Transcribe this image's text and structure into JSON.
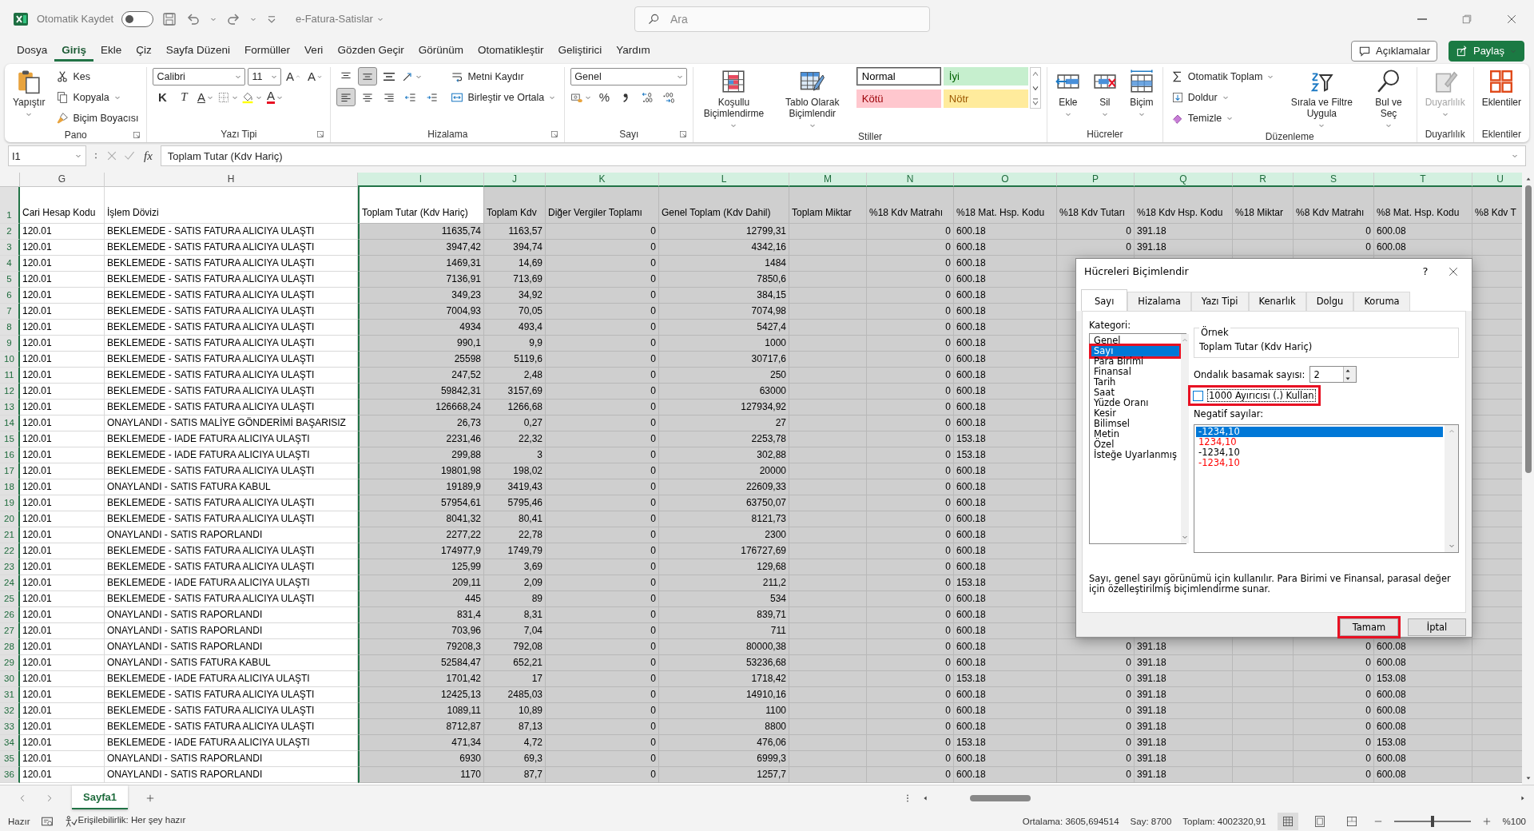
{
  "titlebar": {
    "autosave_label": "Otomatik Kaydet",
    "autosave_on": false,
    "file_name": "e-Fatura-Satislar",
    "search": {
      "placeholder": "Ara"
    }
  },
  "menu": [
    {
      "label": "Dosya",
      "selected": false
    },
    {
      "label": "Giriş",
      "selected": true
    },
    {
      "label": "Ekle",
      "selected": false
    },
    {
      "label": "Çiz",
      "selected": false
    },
    {
      "label": "Sayfa Düzeni",
      "selected": false
    },
    {
      "label": "Formüller",
      "selected": false
    },
    {
      "label": "Veri",
      "selected": false
    },
    {
      "label": "Gözden Geçir",
      "selected": false
    },
    {
      "label": "Görünüm",
      "selected": false
    },
    {
      "label": "Otomatikleştir",
      "selected": false
    },
    {
      "label": "Geliştirici",
      "selected": false
    },
    {
      "label": "Yardım",
      "selected": false
    }
  ],
  "header_buttons": [
    {
      "label": "Açıklamalar",
      "kind": "outline"
    },
    {
      "label": "Paylaş",
      "kind": "primary"
    }
  ],
  "ribbon": [
    {
      "label": "Pano",
      "launcher": true,
      "blocks": [
        {
          "kind": "large",
          "label": "Yapıştır",
          "dropdown": true
        },
        {
          "kind": "stack",
          "lines": [
            [
              {
                "kind": "small",
                "label": "Kes",
                "dropdown": false
              }
            ],
            [
              {
                "kind": "small",
                "label": "Kopyala",
                "dropdown": true
              }
            ],
            [
              {
                "kind": "small",
                "label": "Biçim Boyacısı",
                "dropdown": false
              }
            ]
          ]
        }
      ]
    },
    {
      "label": "Yazı Tipi",
      "launcher": true,
      "blocks": [
        {
          "kind": "stack",
          "lines": [
            [
              {
                "kind": "combo",
                "value": "Calibri"
              },
              {
                "kind": "combo",
                "value": "11"
              },
              {
                "kind": "glyph",
                "text": "A"
              },
              {
                "kind": "glyph",
                "text": "A"
              }
            ],
            [
              {
                "kind": "glyph",
                "text": "K"
              },
              {
                "kind": "glyph",
                "text": "T"
              },
              {
                "kind": "glyph",
                "text": "A",
                "dropdown": true
              },
              {
                "kind": "icon",
                "dropdown": true
              },
              {
                "kind": "icon",
                "dropdown": true
              },
              {
                "kind": "glyph",
                "text": "A",
                "dropdown": true
              }
            ]
          ]
        }
      ]
    },
    {
      "label": "Hizalama",
      "launcher": true,
      "blocks": [
        {
          "kind": "stack",
          "lines": [
            [
              {
                "kind": "icon",
                "selected": false
              },
              {
                "kind": "icon",
                "selected": true
              },
              {
                "kind": "icon",
                "selected": false
              },
              {
                "kind": "icon",
                "selected": false,
                "dropdown": true
              }
            ],
            [
              {
                "kind": "icon",
                "selected": true
              },
              {
                "kind": "icon",
                "selected": false
              },
              {
                "kind": "icon",
                "selected": false
              },
              {
                "kind": "icon",
                "selected": false
              },
              {
                "kind": "icon",
                "selected": false
              }
            ]
          ]
        },
        {
          "kind": "stack",
          "lines": [
            [
              {
                "kind": "small",
                "label": "Metni Kaydır",
                "dropdown": false
              }
            ],
            [
              {
                "kind": "small",
                "label": "Birleştir ve Ortala",
                "dropdown": true
              }
            ]
          ]
        }
      ]
    },
    {
      "label": "Sayı",
      "launcher": true,
      "blocks": [
        {
          "kind": "stack",
          "lines": [
            [
              {
                "kind": "combo",
                "value": "Genel"
              }
            ],
            [
              {
                "kind": "icon",
                "dropdown": true
              },
              {
                "kind": "glyph",
                "text": "%"
              },
              {
                "kind": "icon"
              },
              {
                "kind": "icon"
              },
              {
                "kind": "icon"
              }
            ]
          ]
        }
      ]
    },
    {
      "label": "Stiller",
      "launcher": false,
      "blocks": [
        {
          "kind": "large",
          "label": "Koşullu Biçimlendirme",
          "dropdown": true
        },
        {
          "kind": "large",
          "label": "Tablo Olarak Biçimlendir",
          "dropdown": true
        },
        {
          "kind": "gallery",
          "styles": [
            {
              "label": "Normal",
              "color": "#ffffff"
            },
            {
              "label": "İyi",
              "color": "#c6efce"
            },
            {
              "label": "Kötü",
              "color": "#ffc7ce"
            },
            {
              "label": "Nötr",
              "color": "#ffeb9c"
            }
          ]
        }
      ]
    },
    {
      "label": "Hücreler",
      "launcher": false,
      "blocks": [
        {
          "kind": "large",
          "label": "Ekle",
          "dropdown": true
        },
        {
          "kind": "large",
          "label": "Sil",
          "dropdown": true
        },
        {
          "kind": "large",
          "label": "Biçim",
          "dropdown": true
        }
      ]
    },
    {
      "label": "Düzenleme",
      "launcher": false,
      "blocks": [
        {
          "kind": "stack",
          "lines": [
            [
              {
                "kind": "small",
                "label": "Otomatik Toplam",
                "dropdown": true
              }
            ],
            [
              {
                "kind": "small",
                "label": "Doldur",
                "dropdown": true
              }
            ],
            [
              {
                "kind": "small",
                "label": "Temizle",
                "dropdown": true
              }
            ]
          ]
        },
        {
          "kind": "large",
          "label": "Sırala ve Filtre Uygula",
          "dropdown": true
        },
        {
          "kind": "large",
          "label": "Bul ve Seç",
          "dropdown": true
        }
      ]
    },
    {
      "label": "Duyarlılık",
      "launcher": false,
      "blocks": [
        {
          "kind": "large",
          "label": "Duyarlılık",
          "dropdown": true,
          "disabled": true
        }
      ]
    },
    {
      "label": "Eklentiler",
      "blocks": [
        {
          "kind": "large",
          "label": "Eklentiler",
          "dropdown": false
        }
      ]
    }
  ],
  "formula_bar": {
    "name_box": "I1",
    "fx": "fx",
    "formula": "Toplam Tutar (Kdv Hariç)"
  },
  "sheet": {
    "columns": [
      {
        "letter": "G",
        "selected": false,
        "kind": "text"
      },
      {
        "letter": "H",
        "selected": false,
        "kind": "text"
      },
      {
        "letter": "I",
        "selected": true,
        "kind": "number"
      },
      {
        "letter": "J",
        "selected": true,
        "kind": "number"
      },
      {
        "letter": "K",
        "selected": true,
        "kind": "number"
      },
      {
        "letter": "L",
        "selected": true,
        "kind": "number"
      },
      {
        "letter": "M",
        "selected": true,
        "kind": "number"
      },
      {
        "letter": "N",
        "selected": true,
        "kind": "number"
      },
      {
        "letter": "O",
        "selected": true,
        "kind": "text"
      },
      {
        "letter": "P",
        "selected": true,
        "kind": "number"
      },
      {
        "letter": "Q",
        "selected": true,
        "kind": "text"
      },
      {
        "letter": "R",
        "selected": true,
        "kind": "number"
      },
      {
        "letter": "S",
        "selected": true,
        "kind": "number"
      },
      {
        "letter": "T",
        "selected": true,
        "kind": "text"
      },
      {
        "letter": "U",
        "selected": true,
        "kind": "number"
      }
    ],
    "rows": [
      {
        "n": "1",
        "g": "Cari Hesap Kodu",
        "h": "İşlem Dövizi",
        "i": "Toplam Tutar (Kdv Hariç)",
        "j": "Toplam Kdv",
        "k": "Diğer Vergiler Toplamı",
        "l": "Genel Toplam  (Kdv Dahil)",
        "m": "Toplam Miktar",
        "n_": "%18 Kdv Matrahı",
        "o": "%18 Mat. Hsp. Kodu",
        "p": "%18 Kdv Tutarı",
        "q": "%18 Kdv Hsp. Kodu",
        "r": "%18 Miktar",
        "s": "%8 Kdv Matrahı",
        "t": "%8 Mat. Hsp. Kodu",
        "u": "%8 Kdv T"
      },
      {
        "n": "2",
        "g": "120.01",
        "h": "BEKLEMEDE - SATIS FATURA ALICIYA ULAŞTI",
        "i": "11635,74",
        "j": "1163,57",
        "k": "0",
        "l": "12799,31",
        "n_": "0",
        "o": "600.18",
        "p": "0",
        "q": "391.18",
        "s": "0",
        "t": "600.08"
      },
      {
        "n": "3",
        "g": "120.01",
        "h": "BEKLEMEDE - SATIS FATURA ALICIYA ULAŞTI",
        "i": "3947,42",
        "j": "394,74",
        "k": "0",
        "l": "4342,16",
        "n_": "0",
        "o": "600.18",
        "p": "0",
        "q": "391.18",
        "s": "0",
        "t": "600.08"
      },
      {
        "n": "4",
        "g": "120.01",
        "h": "BEKLEMEDE - SATIS FATURA ALICIYA ULAŞTI",
        "i": "1469,31",
        "j": "14,69",
        "k": "0",
        "l": "1484",
        "n_": "0",
        "o": "600.18"
      },
      {
        "n": "5",
        "g": "120.01",
        "h": "BEKLEMEDE - SATIS FATURA ALICIYA ULAŞTI",
        "i": "7136,91",
        "j": "713,69",
        "k": "0",
        "l": "7850,6",
        "n_": "0",
        "o": "600.18"
      },
      {
        "n": "6",
        "g": "120.01",
        "h": "BEKLEMEDE - SATIS FATURA ALICIYA ULAŞTI",
        "i": "349,23",
        "j": "34,92",
        "k": "0",
        "l": "384,15",
        "n_": "0",
        "o": "600.18"
      },
      {
        "n": "7",
        "g": "120.01",
        "h": "BEKLEMEDE - SATIS FATURA ALICIYA ULAŞTI",
        "i": "7004,93",
        "j": "70,05",
        "k": "0",
        "l": "7074,98",
        "n_": "0",
        "o": "600.18"
      },
      {
        "n": "8",
        "g": "120.01",
        "h": "BEKLEMEDE - SATIS FATURA ALICIYA ULAŞTI",
        "i": "4934",
        "j": "493,4",
        "k": "0",
        "l": "5427,4",
        "n_": "0",
        "o": "600.18"
      },
      {
        "n": "9",
        "g": "120.01",
        "h": "BEKLEMEDE - SATIS FATURA ALICIYA ULAŞTI",
        "i": "990,1",
        "j": "9,9",
        "k": "0",
        "l": "1000",
        "n_": "0",
        "o": "600.18"
      },
      {
        "n": "10",
        "g": "120.01",
        "h": "BEKLEMEDE - SATIS FATURA ALICIYA ULAŞTI",
        "i": "25598",
        "j": "5119,6",
        "k": "0",
        "l": "30717,6",
        "n_": "0",
        "o": "600.18"
      },
      {
        "n": "11",
        "g": "120.01",
        "h": "BEKLEMEDE - SATIS FATURA ALICIYA ULAŞTI",
        "i": "247,52",
        "j": "2,48",
        "k": "0",
        "l": "250",
        "n_": "0",
        "o": "600.18"
      },
      {
        "n": "12",
        "g": "120.01",
        "h": "BEKLEMEDE - SATIS FATURA ALICIYA ULAŞTI",
        "i": "59842,31",
        "j": "3157,69",
        "k": "0",
        "l": "63000",
        "n_": "0",
        "o": "600.18"
      },
      {
        "n": "13",
        "g": "120.01",
        "h": "BEKLEMEDE - SATIS FATURA ALICIYA ULAŞTI",
        "i": "126668,24",
        "j": "1266,68",
        "k": "0",
        "l": "127934,92",
        "n_": "0",
        "o": "600.18"
      },
      {
        "n": "14",
        "g": "120.01",
        "h": "ONAYLANDI - SATIS MALİYE GÖNDERİMİ BAŞARISIZ",
        "i": "26,73",
        "j": "0,27",
        "k": "0",
        "l": "27",
        "n_": "0",
        "o": "600.18"
      },
      {
        "n": "15",
        "g": "120.01",
        "h": "BEKLEMEDE - IADE FATURA ALICIYA ULAŞTI",
        "i": "2231,46",
        "j": "22,32",
        "k": "0",
        "l": "2253,78",
        "n_": "0",
        "o": "153.18"
      },
      {
        "n": "16",
        "g": "120.01",
        "h": "BEKLEMEDE - IADE FATURA ALICIYA ULAŞTI",
        "i": "299,88",
        "j": "3",
        "k": "0",
        "l": "302,88",
        "n_": "0",
        "o": "153.18"
      },
      {
        "n": "17",
        "g": "120.01",
        "h": "BEKLEMEDE - SATIS FATURA ALICIYA ULAŞTI",
        "i": "19801,98",
        "j": "198,02",
        "k": "0",
        "l": "20000",
        "n_": "0",
        "o": "600.18"
      },
      {
        "n": "18",
        "g": "120.01",
        "h": "ONAYLANDI - SATIS FATURA KABUL",
        "i": "19189,9",
        "j": "3419,43",
        "k": "0",
        "l": "22609,33",
        "n_": "0",
        "o": "600.18"
      },
      {
        "n": "19",
        "g": "120.01",
        "h": "BEKLEMEDE - SATIS FATURA ALICIYA ULAŞTI",
        "i": "57954,61",
        "j": "5795,46",
        "k": "0",
        "l": "63750,07",
        "n_": "0",
        "o": "600.18"
      },
      {
        "n": "20",
        "g": "120.01",
        "h": "BEKLEMEDE - SATIS FATURA ALICIYA ULAŞTI",
        "i": "8041,32",
        "j": "80,41",
        "k": "0",
        "l": "8121,73",
        "n_": "0",
        "o": "600.18"
      },
      {
        "n": "21",
        "g": "120.01",
        "h": "ONAYLANDI - SATIS RAPORLANDI",
        "i": "2277,22",
        "j": "22,78",
        "k": "0",
        "l": "2300",
        "n_": "0",
        "o": "600.18"
      },
      {
        "n": "22",
        "g": "120.01",
        "h": "BEKLEMEDE - SATIS FATURA ALICIYA ULAŞTI",
        "i": "174977,9",
        "j": "1749,79",
        "k": "0",
        "l": "176727,69",
        "n_": "0",
        "o": "600.18"
      },
      {
        "n": "23",
        "g": "120.01",
        "h": "BEKLEMEDE - SATIS FATURA ALICIYA ULAŞTI",
        "i": "125,99",
        "j": "3,69",
        "k": "0",
        "l": "129,68",
        "n_": "0",
        "o": "600.18"
      },
      {
        "n": "24",
        "g": "120.01",
        "h": "BEKLEMEDE - IADE FATURA ALICIYA ULAŞTI",
        "i": "209,11",
        "j": "2,09",
        "k": "0",
        "l": "211,2",
        "n_": "0",
        "o": "153.18"
      },
      {
        "n": "25",
        "g": "120.01",
        "h": "BEKLEMEDE - SATIS FATURA ALICIYA ULAŞTI",
        "i": "445",
        "j": "89",
        "k": "0",
        "l": "534",
        "n_": "0",
        "o": "600.18"
      },
      {
        "n": "26",
        "g": "120.01",
        "h": "ONAYLANDI - SATIS RAPORLANDI",
        "i": "831,4",
        "j": "8,31",
        "k": "0",
        "l": "839,71",
        "n_": "0",
        "o": "600.18"
      },
      {
        "n": "27",
        "g": "120.01",
        "h": "ONAYLANDI - SATIS RAPORLANDI",
        "i": "703,96",
        "j": "7,04",
        "k": "0",
        "l": "711",
        "n_": "0",
        "o": "600.18"
      },
      {
        "n": "28",
        "g": "120.01",
        "h": "ONAYLANDI - SATIS RAPORLANDI",
        "i": "79208,3",
        "j": "792,08",
        "k": "0",
        "l": "80000,38",
        "n_": "0",
        "o": "600.18",
        "p": "0",
        "q": "391.18",
        "s": "0",
        "t": "600.08"
      },
      {
        "n": "29",
        "g": "120.01",
        "h": "ONAYLANDI - SATIS FATURA KABUL",
        "i": "52584,47",
        "j": "652,21",
        "k": "0",
        "l": "53236,68",
        "n_": "0",
        "o": "600.18",
        "p": "0",
        "q": "391.18",
        "s": "0",
        "t": "600.08"
      },
      {
        "n": "30",
        "g": "120.01",
        "h": "BEKLEMEDE - IADE FATURA ALICIYA ULAŞTI",
        "i": "1701,42",
        "j": "17",
        "k": "0",
        "l": "1718,42",
        "n_": "0",
        "o": "153.18",
        "p": "0",
        "q": "391.18",
        "s": "0",
        "t": "153.08"
      },
      {
        "n": "31",
        "g": "120.01",
        "h": "BEKLEMEDE - SATIS FATURA ALICIYA ULAŞTI",
        "i": "12425,13",
        "j": "2485,03",
        "k": "0",
        "l": "14910,16",
        "n_": "0",
        "o": "600.18",
        "p": "0",
        "q": "391.18",
        "s": "0",
        "t": "600.08"
      },
      {
        "n": "32",
        "g": "120.01",
        "h": "BEKLEMEDE - SATIS FATURA ALICIYA ULAŞTI",
        "i": "1089,11",
        "j": "10,89",
        "k": "0",
        "l": "1100",
        "n_": "0",
        "o": "600.18",
        "p": "0",
        "q": "391.18",
        "s": "0",
        "t": "600.08"
      },
      {
        "n": "33",
        "g": "120.01",
        "h": "BEKLEMEDE - SATIS FATURA ALICIYA ULAŞTI",
        "i": "8712,87",
        "j": "87,13",
        "k": "0",
        "l": "8800",
        "n_": "0",
        "o": "600.18",
        "p": "0",
        "q": "391.18",
        "s": "0",
        "t": "600.08"
      },
      {
        "n": "34",
        "g": "120.01",
        "h": "BEKLEMEDE - IADE FATURA ALICIYA ULAŞTI",
        "i": "471,34",
        "j": "4,72",
        "k": "0",
        "l": "476,06",
        "n_": "0",
        "o": "153.18",
        "p": "0",
        "q": "391.18",
        "s": "0",
        "t": "153.08"
      },
      {
        "n": "35",
        "g": "120.01",
        "h": "ONAYLANDI - SATIS RAPORLANDI",
        "i": "6930",
        "j": "69,3",
        "k": "0",
        "l": "6999,3",
        "n_": "0",
        "o": "600.18",
        "p": "0",
        "q": "391.18",
        "s": "0",
        "t": "600.08"
      },
      {
        "n": "36",
        "g": "120.01",
        "h": "ONAYLANDI - SATIS RAPORLANDI",
        "i": "1170",
        "j": "87,7",
        "k": "0",
        "l": "1257,7",
        "n_": "0",
        "o": "600.18",
        "p": "0",
        "q": "391.18",
        "s": "0",
        "t": "600.08"
      }
    ]
  },
  "dialog": {
    "title": "Hücreleri Biçimlendir",
    "help": "?",
    "tabs": [
      {
        "label": "Sayı",
        "selected": true
      },
      {
        "label": "Hizalama",
        "selected": false
      },
      {
        "label": "Yazı Tipi",
        "selected": false
      },
      {
        "label": "Kenarlık",
        "selected": false
      },
      {
        "label": "Dolgu",
        "selected": false
      },
      {
        "label": "Koruma",
        "selected": false
      }
    ],
    "category_label": "Kategori:",
    "categories": [
      {
        "label": "Genel",
        "selected": false,
        "highlighted": false
      },
      {
        "label": "Sayı",
        "selected": true,
        "highlighted": true
      },
      {
        "label": "Para Birimi",
        "selected": false,
        "highlighted": false
      },
      {
        "label": "Finansal",
        "selected": false,
        "highlighted": false
      },
      {
        "label": "Tarih",
        "selected": false,
        "highlighted": false
      },
      {
        "label": "Saat",
        "selected": false,
        "highlighted": false
      },
      {
        "label": "Yüzde Oranı",
        "selected": false,
        "highlighted": false
      },
      {
        "label": "Kesir",
        "selected": false,
        "highlighted": false
      },
      {
        "label": "Bilimsel",
        "selected": false,
        "highlighted": false
      },
      {
        "label": "Metin",
        "selected": false,
        "highlighted": false
      },
      {
        "label": "Özel",
        "selected": false,
        "highlighted": false
      },
      {
        "label": "İsteğe Uyarlanmış",
        "selected": false,
        "highlighted": false
      }
    ],
    "sample_label": "Örnek",
    "sample": "Toplam Tutar (Kdv Hariç)",
    "decimals_label": "Ondalık basamak sayısı:",
    "decimals": "2",
    "separator": {
      "label": "1000 Ayırıcısı (.) Kullan",
      "checked": false,
      "highlighted": true
    },
    "negative_label": "Negatif sayılar:",
    "negatives": [
      {
        "label": "-1234,10",
        "red": false,
        "selected": true
      },
      {
        "label": "1234,10",
        "red": true,
        "selected": false
      },
      {
        "label": "-1234,10",
        "red": false,
        "selected": false
      },
      {
        "label": "-1234,10",
        "red": true,
        "selected": false
      }
    ],
    "description": "Sayı, genel sayı görünümü için kullanılır. Para Birimi ve Finansal, parasal değer için özelleştirilmiş biçimlendirme sunar.",
    "buttons": [
      {
        "label": "Tamam",
        "highlighted": true
      },
      {
        "label": "İptal",
        "highlighted": false
      }
    ]
  },
  "sheet_tabs": [
    {
      "label": "Sayfa1",
      "selected": true
    }
  ],
  "status": {
    "ready": "Hazır",
    "accessibility": "Erişilebilirlik: Her şey hazır",
    "average": "Ortalama: 3605,694514",
    "count": "Say: 8700",
    "sum": "Toplam: 4002320,91",
    "zoom": "%100",
    "zoom_slider": {
      "level": 0.5
    },
    "views": [
      {
        "selected": true
      },
      {
        "selected": false
      },
      {
        "selected": false
      }
    ]
  }
}
